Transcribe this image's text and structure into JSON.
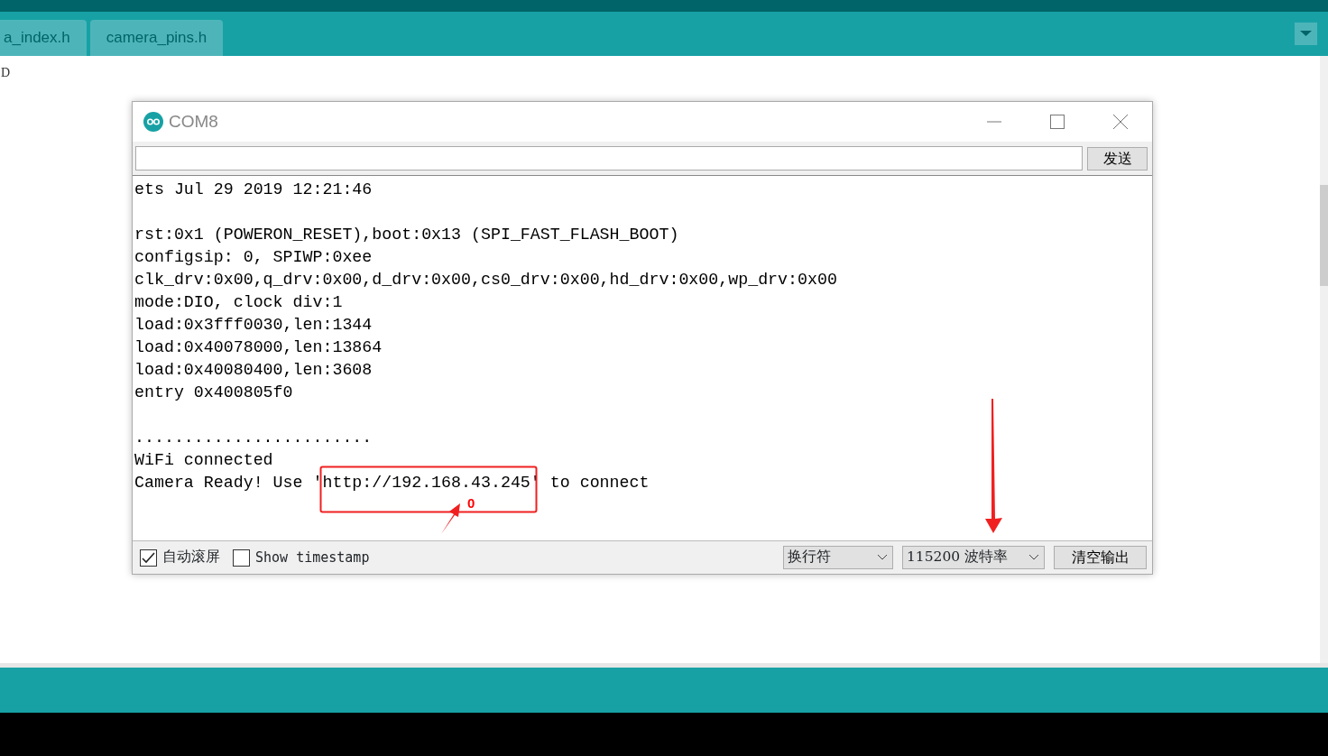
{
  "tabs": [
    {
      "label": "a_index.h",
      "selected": false
    },
    {
      "label": "camera_pins.h",
      "selected": false
    }
  ],
  "editor_text": "D",
  "serial_monitor": {
    "title": "COM8",
    "send_button": "发送",
    "output_lines": [
      {
        "kind": "text",
        "text": "ets Jul 29 2019 12:21:46"
      },
      {
        "kind": "blank"
      },
      {
        "kind": "text",
        "text": "rst:0x1 (POWERON_RESET),boot:0x13 (SPI_FAST_FLASH_BOOT)"
      },
      {
        "kind": "text",
        "text": "configsip: 0, SPIWP:0xee"
      },
      {
        "kind": "text",
        "text": "clk_drv:0x00,q_drv:0x00,d_drv:0x00,cs0_drv:0x00,hd_drv:0x00,wp_drv:0x00"
      },
      {
        "kind": "text",
        "text": "mode:DIO, clock div:1"
      },
      {
        "kind": "text",
        "text": "load:0x3fff0030,len:1344"
      },
      {
        "kind": "text",
        "text": "load:0x40078000,len:13864"
      },
      {
        "kind": "text",
        "text": "load:0x40080400,len:3608"
      },
      {
        "kind": "text",
        "text": "entry 0x400805f0"
      },
      {
        "kind": "blank"
      },
      {
        "kind": "text",
        "text": "........................"
      },
      {
        "kind": "text",
        "text": "WiFi connected"
      },
      {
        "kind": "text",
        "text": "Camera Ready! Use 'http://192.168.43.245' to connect"
      }
    ],
    "autoscroll": {
      "label": "自动滚屏",
      "checked": true
    },
    "timestamp": {
      "label": "Show timestamp",
      "checked": false
    },
    "line_ending": "换行符",
    "baud_rate": "115200 波特率",
    "clear_button": "清空输出"
  },
  "annotation": {
    "note": "0"
  }
}
